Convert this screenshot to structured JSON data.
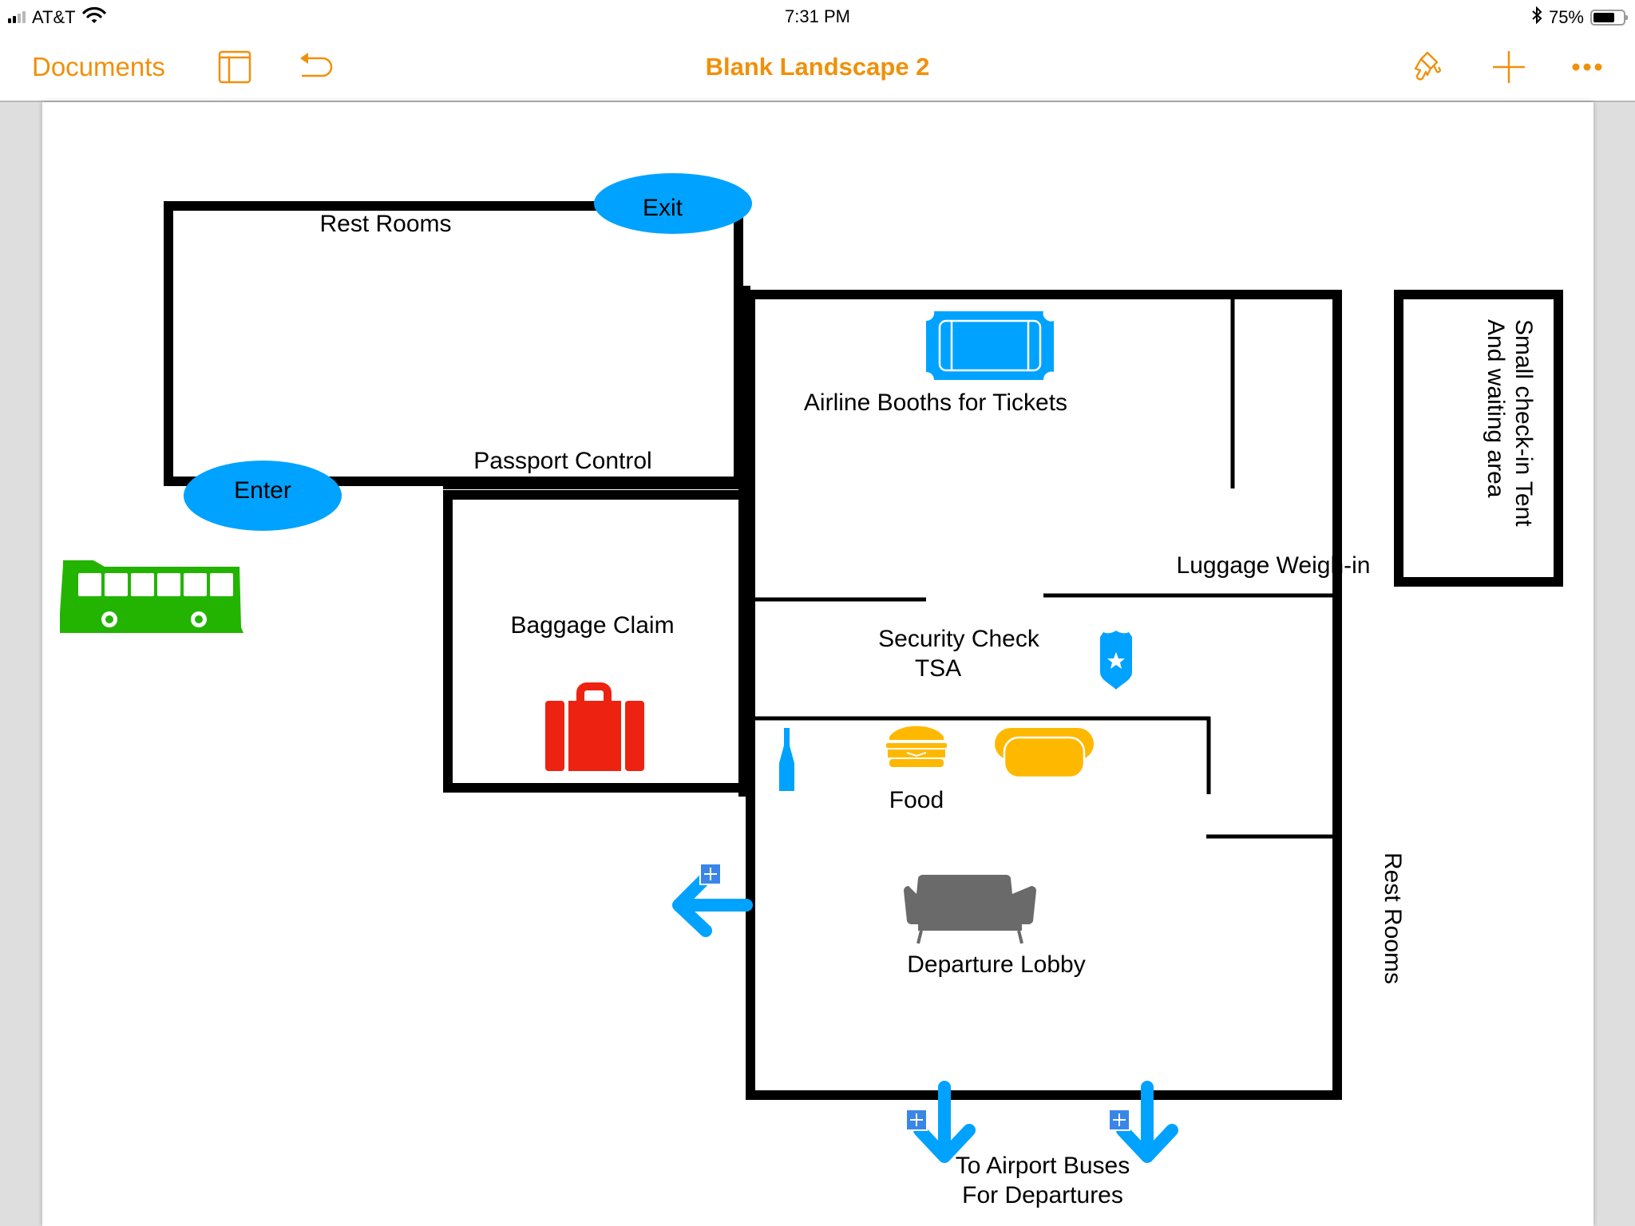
{
  "status_bar": {
    "carrier": "AT&T",
    "signal_bars_active": 2,
    "signal_bars_total": 4,
    "time": "7:31 PM",
    "bluetooth": "bluetooth-icon",
    "battery_percent_label": "75%",
    "battery_level": 0.75
  },
  "toolbar": {
    "documents_label": "Documents",
    "title": "Blank Landscape 2",
    "icons": [
      "sidebar-view-icon",
      "undo-icon",
      "format-brush-icon",
      "add-icon",
      "more-icon"
    ],
    "accent_color": "#f0900a"
  },
  "floor_plan": {
    "colors": {
      "wall": "#000000",
      "ellipse": "#00a2ff",
      "ticket": "#00a2ff",
      "badge": "#00a2ff",
      "bottle": "#00a2ff",
      "arrow": "#00a2ff",
      "bus": "#22b400",
      "suitcase": "#ee2211",
      "food": "#ffb800",
      "sofa": "#6a6a6a",
      "handle": "#3a86e8"
    },
    "ellipses": {
      "exit": "Exit",
      "enter": "Enter"
    },
    "labels": {
      "rest_rooms_top": "Rest Rooms",
      "passport_control": "Passport Control",
      "baggage_claim": "Baggage Claim",
      "airline_booths": "Airline Booths for Tickets",
      "luggage_weigh_in": "Luggage Weigh-in",
      "security_line1": "Security Check",
      "security_line2": "TSA",
      "food": "Food",
      "departure_lobby": "Departure Lobby",
      "rest_rooms_right": "Rest Rooms",
      "tent_line1": "Small check-in Tent",
      "tent_line2": "And waiting area",
      "buses_line1": "To Airport Buses",
      "buses_line2": "For Departures"
    },
    "icons": [
      "bus-icon",
      "suitcase-icon",
      "ticket-icon",
      "police-badge-icon",
      "bottle-icon",
      "burger-icon",
      "hotdog-icon",
      "sofa-icon",
      "arrow-left-icon",
      "arrow-down-icon",
      "arrow-down-icon"
    ]
  }
}
